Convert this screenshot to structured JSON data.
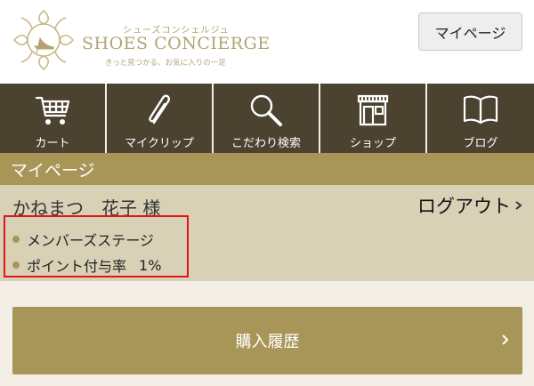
{
  "header": {
    "logo": {
      "subtitle": "シューズコンシェルジュ",
      "name": "SHOES CONCIERGE",
      "tagline": "きっと見つかる、お気に入りの一足"
    },
    "mypage_button": "マイページ"
  },
  "nav": {
    "items": [
      {
        "label": "カート",
        "icon": "cart-icon"
      },
      {
        "label": "マイクリップ",
        "icon": "paperclip-icon"
      },
      {
        "label": "こだわり検索",
        "icon": "search-icon"
      },
      {
        "label": "ショップ",
        "icon": "shop-icon"
      },
      {
        "label": "ブログ",
        "icon": "book-icon"
      }
    ]
  },
  "section": {
    "title": "マイページ"
  },
  "user": {
    "name": "かねまつ　花子 様",
    "logout": "ログアウト",
    "stage_label": "メンバーズステージ",
    "points_label": "ポイント付与率",
    "points_value": "1%"
  },
  "actions": {
    "history": "購入履歴"
  },
  "colors": {
    "nav_bg": "#4b4230",
    "gold": "#a89558",
    "panel": "#d9d1b6",
    "highlight": "#e0141c"
  }
}
